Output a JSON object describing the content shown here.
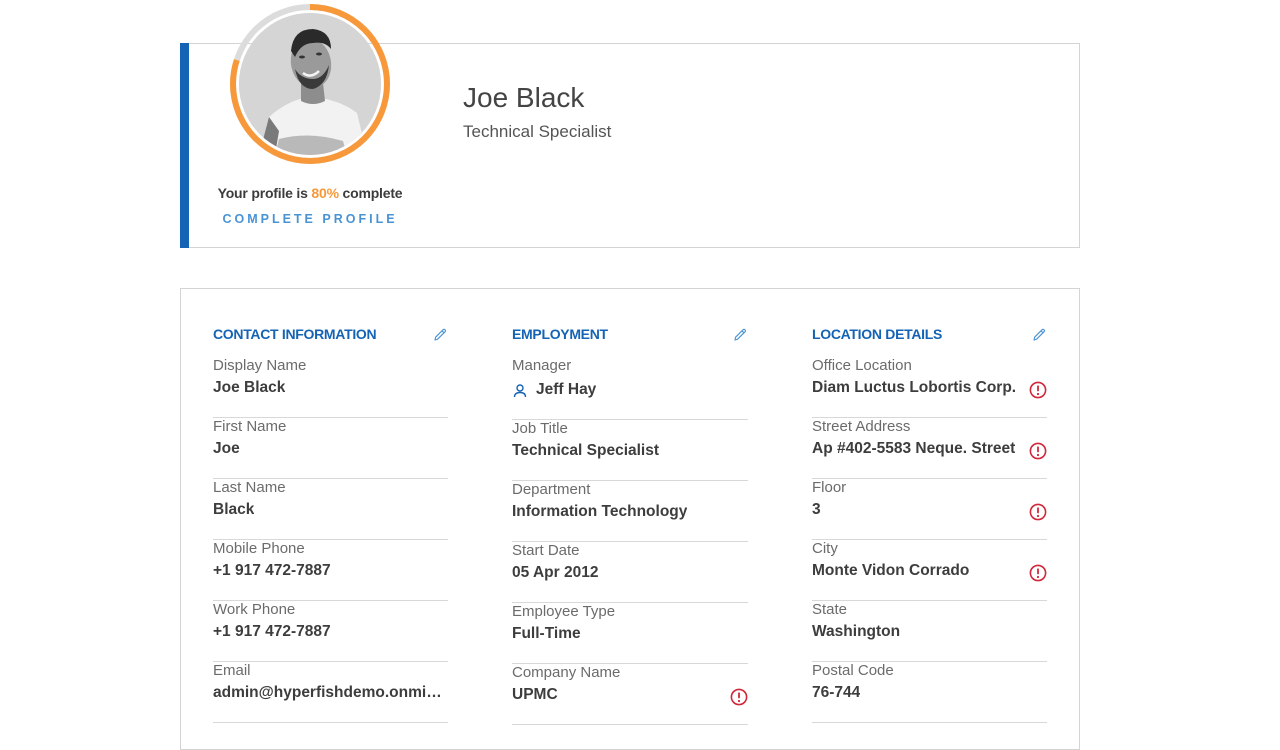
{
  "colors": {
    "accent_blue": "#1463b4",
    "link_blue": "#4a93d3",
    "progress_orange": "#f7993a",
    "progress_track": "#dcdcdc",
    "warning_red": "#d0283a",
    "divider": "#d8d8d8"
  },
  "profile": {
    "name": "Joe Black",
    "title": "Technical Specialist",
    "avatar_alt": "Profile photo of Joe Black",
    "completion_percent": 80,
    "status_prefix": "Your profile is ",
    "status_pct_text": "80%",
    "status_suffix": " complete",
    "complete_link": "COMPLETE PROFILE"
  },
  "sections": [
    {
      "title": "CONTACT INFORMATION",
      "edit_icon": "pencil-icon",
      "fields": [
        {
          "label": "Display Name",
          "value": "Joe Black"
        },
        {
          "label": "First Name",
          "value": "Joe"
        },
        {
          "label": "Last Name",
          "value": "Black"
        },
        {
          "label": "Mobile Phone",
          "value": "+1 917 472-7887"
        },
        {
          "label": "Work Phone",
          "value": "+1 917 472-7887"
        },
        {
          "label": "Email",
          "value": "admin@hyperfishdemo.onmicr..."
        }
      ]
    },
    {
      "title": "EMPLOYMENT",
      "edit_icon": "pencil-icon",
      "fields": [
        {
          "label": "Manager",
          "value": "Jeff Hay",
          "icon": "person-icon"
        },
        {
          "label": "Job Title",
          "value": "Technical Specialist"
        },
        {
          "label": "Department",
          "value": "Information Technology"
        },
        {
          "label": "Start Date",
          "value": "05 Apr 2012"
        },
        {
          "label": "Employee Type",
          "value": "Full-Time"
        },
        {
          "label": "Company Name",
          "value": "UPMC",
          "warning": true
        }
      ]
    },
    {
      "title": "LOCATION DETAILS",
      "edit_icon": "pencil-icon",
      "fields": [
        {
          "label": "Office Location",
          "value": "Diam Luctus Lobortis Corp.",
          "warning": true
        },
        {
          "label": "Street Address",
          "value": "Ap #402-5583 Neque. Street",
          "warning": true
        },
        {
          "label": "Floor",
          "value": "3",
          "warning": true
        },
        {
          "label": "City",
          "value": "Monte Vidon Corrado",
          "warning": true
        },
        {
          "label": "State",
          "value": "Washington"
        },
        {
          "label": "Postal Code",
          "value": "76-744"
        }
      ]
    }
  ]
}
